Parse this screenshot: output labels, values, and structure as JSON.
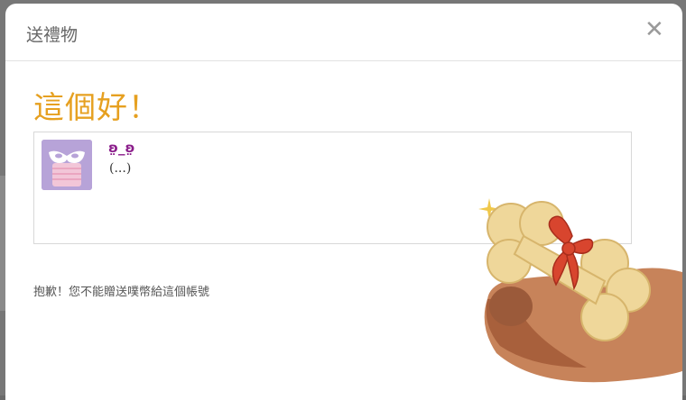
{
  "dialog": {
    "title": "送禮物",
    "close_label": "✕",
    "headline": "這個好！",
    "user": {
      "nickname": "ʚ̤_ʚ̤",
      "description": "(...)"
    },
    "error_message": "抱歉！您不能贈送噗幣給這個帳號"
  },
  "colors": {
    "headline": "#e6a020",
    "nickname": "#8a1c8a",
    "avatar_bg": "#b7a3d8"
  },
  "icons": {
    "close": "close-icon",
    "avatar": "masked-avatar",
    "mascot": "bone-with-bow-illustration"
  }
}
